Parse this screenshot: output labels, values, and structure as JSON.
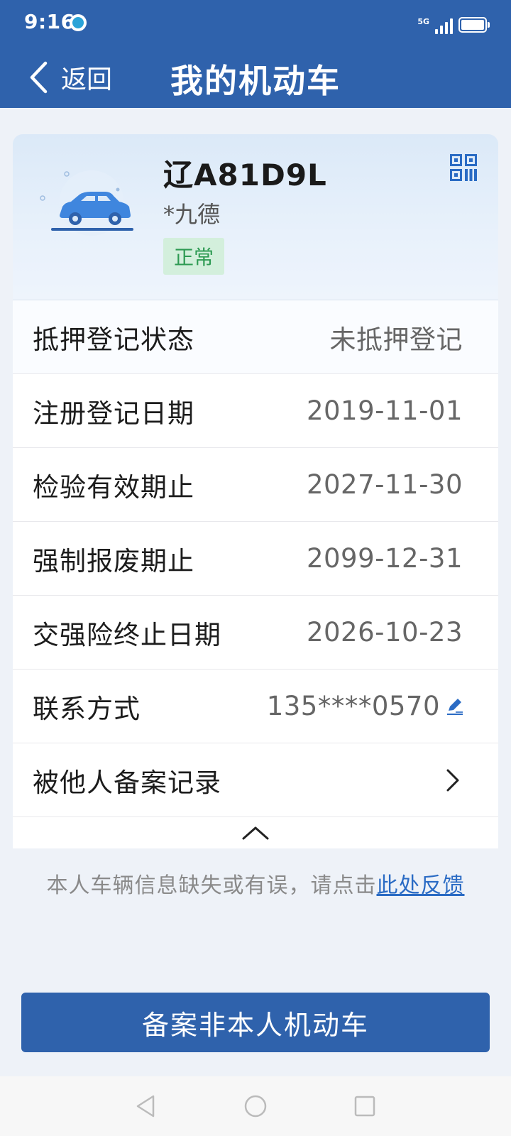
{
  "status_bar": {
    "time": "9:16",
    "network": "5G",
    "app_icon": "browser-icon",
    "signal_icon": "signal-icon",
    "battery_icon": "battery-icon"
  },
  "header": {
    "back_label": "返回",
    "title": "我的机动车",
    "back_icon": "chevron-left-icon"
  },
  "vehicle": {
    "plate": "辽A81D9L",
    "owner": "*九德",
    "status": "正常",
    "status_color": "#2d9a52",
    "qr_icon": "qr-code-icon",
    "car_icon": "car-icon"
  },
  "info_rows": [
    {
      "label": "抵押登记状态",
      "value": "未抵押登记"
    },
    {
      "label": "注册登记日期",
      "value": "2019-11-01"
    },
    {
      "label": "检验有效期止",
      "value": "2027-11-30"
    },
    {
      "label": "强制报废期止",
      "value": "2099-12-31"
    },
    {
      "label": "交强险终止日期",
      "value": "2026-10-23"
    },
    {
      "label": "联系方式",
      "value": "135****0570",
      "icon": "edit-icon"
    },
    {
      "label": "被他人备案记录",
      "icon": "chevron-right-icon"
    }
  ],
  "collapse_icon": "chevron-up-icon",
  "feedback": {
    "text": "本人车辆信息缺失或有误，请点击",
    "link": "此处反馈"
  },
  "primary_button": "备案非本人机动车",
  "nav_bar": [
    "back-triangle-icon",
    "home-circle-icon",
    "recents-square-icon"
  ],
  "colors": {
    "brand_blue": "#2f62ac",
    "link_blue": "#2a6bc4",
    "status_green": "#2d9a52"
  }
}
